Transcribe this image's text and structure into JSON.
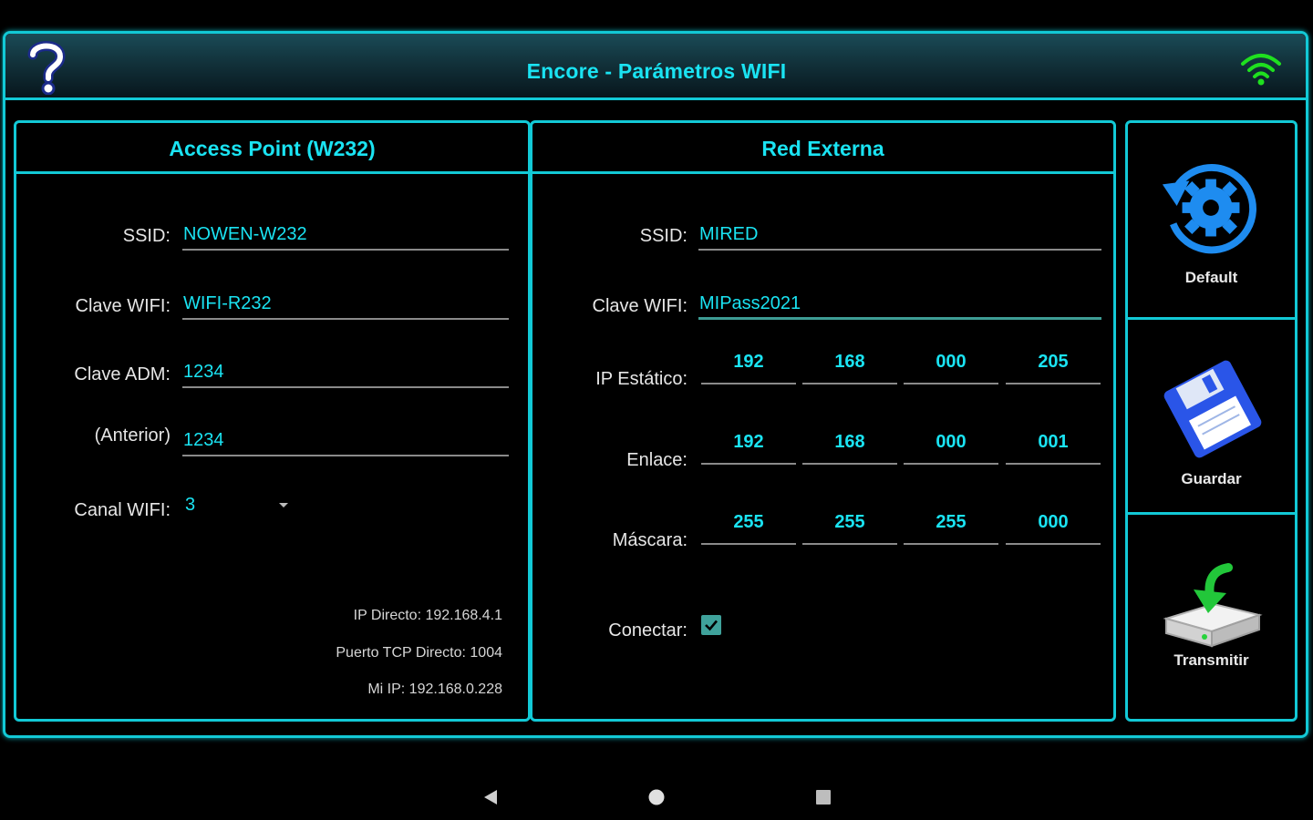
{
  "header": {
    "title": "Encore - Parámetros WIFI",
    "help_icon": "question-mark-icon",
    "wifi_icon": "wifi-signal-icon",
    "accent_color": "#1ae3f2"
  },
  "access_point": {
    "title": "Access Point (W232)",
    "ssid_label": "SSID:",
    "ssid_value": "NOWEN-W232",
    "wifi_key_label": "Clave WIFI:",
    "wifi_key_value": "WIFI-R232",
    "admin_key_label": "Clave ADM:",
    "admin_key_value": "1234",
    "previous_label": "(Anterior)",
    "previous_value": "1234",
    "channel_label": "Canal WIFI:",
    "channel_value": "3",
    "direct_ip": "IP Directo: 192.168.4.1",
    "direct_tcp_port": "Puerto TCP Directo: 1004",
    "my_ip": "Mi IP: 192.168.0.228"
  },
  "external_network": {
    "title": "Red Externa",
    "ssid_label": "SSID:",
    "ssid_value": "MIRED",
    "wifi_key_label": "Clave WIFI:",
    "wifi_key_value": "MIPass2021",
    "static_ip_label": "IP Estático:",
    "static_ip": [
      "192",
      "168",
      "000",
      "205"
    ],
    "gateway_label": "Enlace:",
    "gateway": [
      "192",
      "168",
      "000",
      "001"
    ],
    "mask_label": "Máscara:",
    "mask": [
      "255",
      "255",
      "255",
      "000"
    ],
    "connect_label": "Conectar:",
    "connect_checked": true
  },
  "actions": {
    "default_label": "Default",
    "default_icon": "reset-settings-icon",
    "save_label": "Guardar",
    "save_icon": "floppy-disk-icon",
    "transmit_label": "Transmitir",
    "transmit_icon": "download-to-drive-icon"
  },
  "navbar": {
    "back_icon": "back-triangle-icon",
    "home_icon": "home-circle-icon",
    "recents_icon": "recents-square-icon"
  }
}
